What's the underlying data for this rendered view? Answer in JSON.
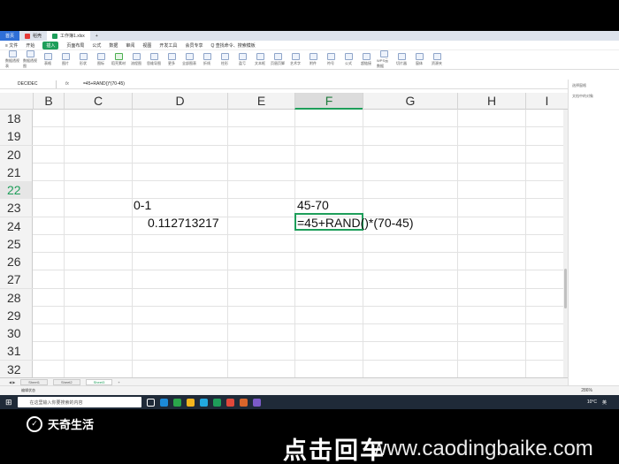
{
  "tabs": [
    {
      "label": "首页",
      "kind": "home"
    },
    {
      "label": "稻壳",
      "kind": "normal"
    },
    {
      "label": "工作簿1.xlsx",
      "kind": "active"
    }
  ],
  "new_tab": "+",
  "menu": [
    "≡ 文件",
    "开始",
    "插入",
    "页面布局",
    "公式",
    "数据",
    "审阅",
    "视图",
    "开发工具",
    "会员专享",
    "Q 查找命令、搜索模板"
  ],
  "ribbon": [
    "数据透视表",
    "数据透视图",
    "表格",
    "图片",
    "形状",
    "图标",
    "稻壳素材",
    "流程图",
    "思维导图",
    "更多",
    "全部图表",
    "折线",
    "柱形",
    "盈亏",
    "文本框",
    "页眉页脚",
    "艺术字",
    "附件",
    "符号",
    "公式",
    "超链接",
    "WPS云数据",
    "切片器",
    "窗体",
    "资源夹"
  ],
  "formula_bar": {
    "name_box": "DECIDEC",
    "fx": "fx",
    "formula": "=45+RAND()*(70-45)"
  },
  "columns": [
    "B",
    "C",
    "D",
    "E",
    "F",
    "G",
    "H",
    "I"
  ],
  "selected_column": "F",
  "rows": [
    "18",
    "19",
    "20",
    "21",
    "22",
    "23",
    "24",
    "25",
    "26",
    "27",
    "28",
    "29",
    "30",
    "31",
    "32"
  ],
  "selected_row": "22",
  "cells": {
    "D21": "0-1",
    "D22": "0.112713217",
    "F21": "45-70",
    "F22": "=45+RAND()*(70-45)"
  },
  "sheets": [
    "Sheet1",
    "Sheet2",
    "Sheet3"
  ],
  "active_sheet": "Sheet3",
  "status": {
    "mode": "编辑状态",
    "zoom": "286%"
  },
  "side_pane": {
    "title": "选择窗格",
    "label": "文档中的对象"
  },
  "taskbar": {
    "search": "在这里输入你要搜索的内容",
    "weather": "10°C",
    "ime": "英"
  },
  "overlay": {
    "brand": "天奇生活",
    "subtitle": "点击回车",
    "watermark": "www.caodingbaike.com"
  },
  "colors": {
    "accent": "#1e9e5a",
    "home_tab": "#2f6fd7",
    "taskbar": "#1f2a38"
  }
}
